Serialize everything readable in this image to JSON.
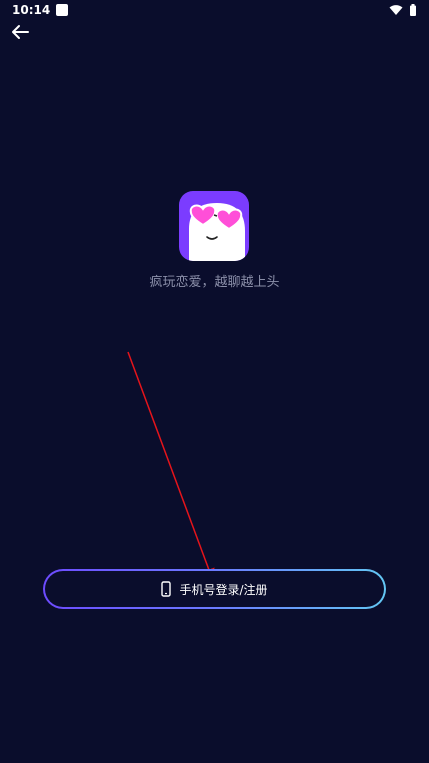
{
  "status_bar": {
    "time": "10:14",
    "icons": [
      "notification-icon",
      "wifi-icon",
      "battery-icon"
    ]
  },
  "header": {
    "back_icon": "back-arrow-icon"
  },
  "app": {
    "logo_icon": "ghost-heart-glasses-logo",
    "tagline": "疯玩恋爱，越聊越上头"
  },
  "login": {
    "phone_icon": "phone-icon",
    "label": "手机号登录/注册",
    "border_gradient": [
      "#6d4bff",
      "#63c7f4"
    ]
  },
  "colors": {
    "background": "#0a0d2c",
    "tagline": "#8b8fa9",
    "annotation": "#e5141b",
    "logo_bg": "#7b3cff",
    "heart": "#ff4fd8"
  }
}
